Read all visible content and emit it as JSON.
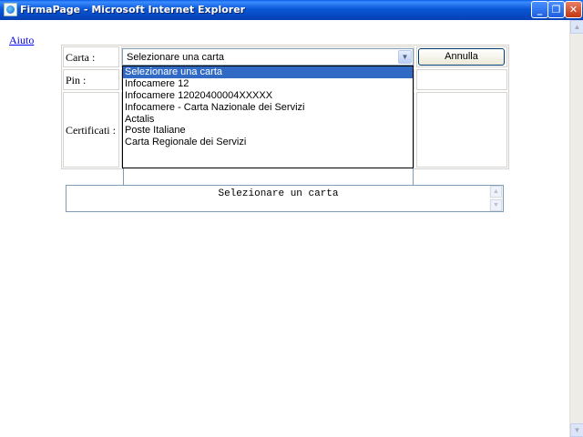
{
  "window": {
    "title": "FirmaPage - Microsoft Internet Explorer",
    "minimize_glyph": "_",
    "restore_glyph": "❐",
    "close_glyph": "✕"
  },
  "page": {
    "help_link": "Aiuto"
  },
  "form": {
    "card_label": "Carta :",
    "pin_label": "Pin :",
    "certificates_label": "Certificati :",
    "card_select_value": "Selezionare una carta",
    "cancel_button": "Annulla",
    "card_options": [
      "Selezionare una carta",
      "Infocamere 12",
      "Infocamere 12020400004XXXXX",
      "Infocamere - Carta Nazionale dei Servizi",
      "Actalis",
      "Poste Italiane",
      "Carta Regionale dei Servizi"
    ],
    "selected_option_index": 0
  },
  "message": {
    "text": "Selezionare un carta"
  },
  "icons": {
    "dropdown_arrow": "chevron-down-icon",
    "scroll_up": "scroll-up-arrow-icon",
    "scroll_down": "scroll-down-arrow-icon"
  },
  "colors": {
    "titlebar": "#0a57d6",
    "selection": "#316ac5",
    "link": "#0000ee"
  }
}
